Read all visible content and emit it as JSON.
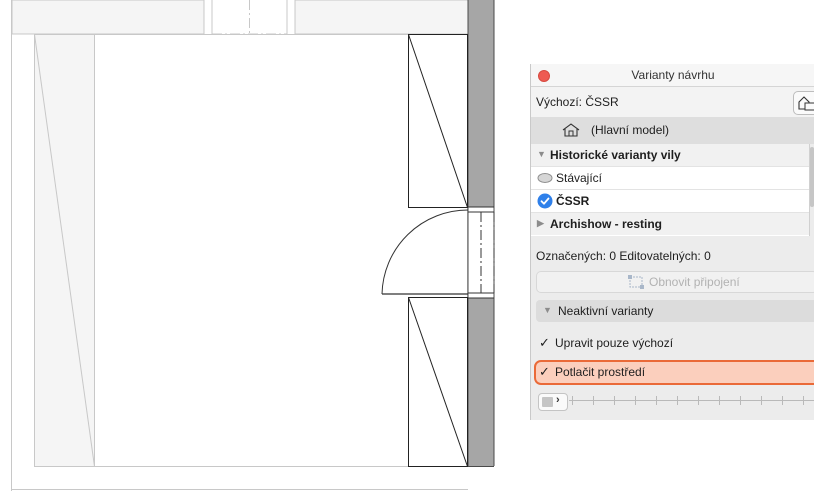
{
  "panel": {
    "title": "Varianty návrhu",
    "default_label": "Výchozí: ČSSR",
    "main_model_label": "(Hlavní model)",
    "list": {
      "group1_label": "Historické varianty vily",
      "item1_label": "Stávající",
      "item2_label": "ČSSR",
      "group2_label": "Archishow - resting"
    },
    "counts_label": "Označených: 0 Editovatelných: 0",
    "refresh_label": "Obnovit připojení",
    "inactive_label": "Neaktivní varianty",
    "edit_default_only_label": "Upravit pouze výchozí",
    "edit_default_only_checked": true,
    "suppress_env_label": "Potlačit prostředí",
    "suppress_env_checked": true,
    "accent_color": "#ea6a38",
    "selected_icon_color": "#2f80ea"
  }
}
